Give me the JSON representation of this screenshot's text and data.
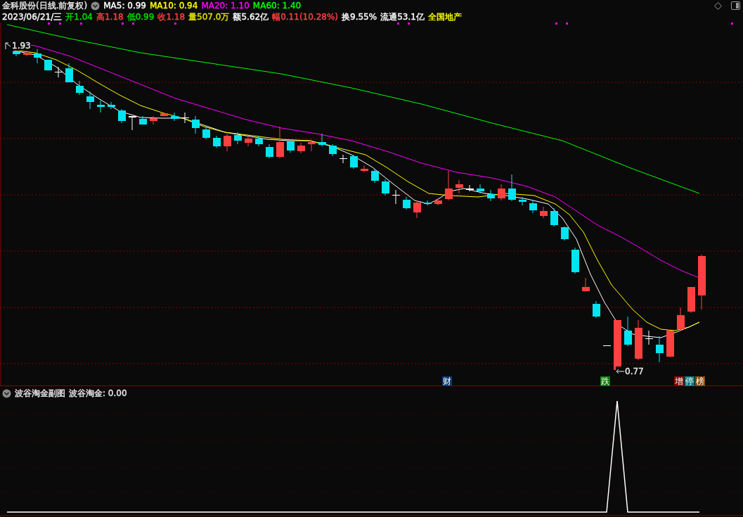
{
  "header": {
    "stock": "金科股份(日线.前复权)",
    "ma": [
      {
        "label": "MA5: 0.99",
        "color": "#ffffff"
      },
      {
        "label": "MA10: 0.94",
        "color": "#ffff00"
      },
      {
        "label": "MA20: 1.10",
        "color": "#ff00ff"
      },
      {
        "label": "MA60: 1.40",
        "color": "#00ff00"
      }
    ]
  },
  "quote": [
    {
      "text": "2023/06/21/三",
      "color": "#ffffff"
    },
    {
      "text": "开1.04",
      "color": "#00e000"
    },
    {
      "text": "高1.18",
      "color": "#ff4040"
    },
    {
      "text": "低0.99",
      "color": "#00e000"
    },
    {
      "text": "收1.18",
      "color": "#ff4040"
    },
    {
      "text": "量507.0万",
      "color": "#e0e000"
    },
    {
      "text": "额5.62亿",
      "color": "#ffffff"
    },
    {
      "text": "幅0.11(10.28%)",
      "color": "#ff4040"
    },
    {
      "text": "换9.55%",
      "color": "#ffffff"
    },
    {
      "text": "流通53.1亿",
      "color": "#ffffff"
    },
    {
      "text": "全国地产",
      "color": "#ffff00"
    }
  ],
  "price_marks": {
    "high": "1.93",
    "low": "0.77"
  },
  "event_tags": [
    {
      "text": "财",
      "color": "#0a3a6e"
    },
    {
      "text": "跌",
      "color": "#0a7a0a"
    },
    {
      "text": "增",
      "color": "#8a0000"
    },
    {
      "text": "停",
      "color": "#0a7a7a"
    },
    {
      "text": "榜",
      "color": "#8a4a00"
    }
  ],
  "indicator": {
    "name": "波谷淘金副图",
    "reading": "波谷淘金: 0.00"
  }
}
